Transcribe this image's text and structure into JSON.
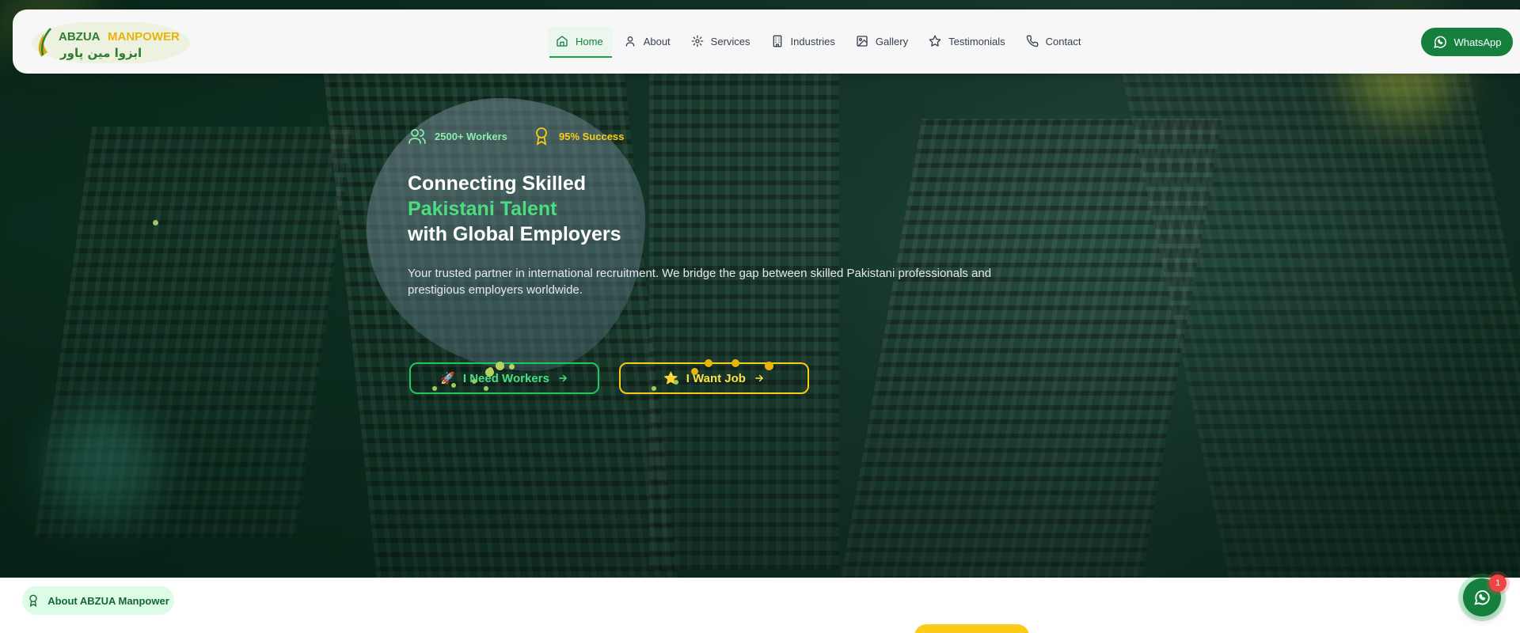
{
  "brand": {
    "name_left": "ABZUA",
    "name_right": "MANPOWER",
    "urdu": "ابزوا مین پاور",
    "colors": {
      "primary_green": "#16a34a",
      "accent_yellow": "#facc15"
    }
  },
  "nav": {
    "items": [
      {
        "label": "Home",
        "icon": "home-icon",
        "active": true
      },
      {
        "label": "About",
        "icon": "user-icon"
      },
      {
        "label": "Services",
        "icon": "gear-icon"
      },
      {
        "label": "Industries",
        "icon": "building-icon"
      },
      {
        "label": "Gallery",
        "icon": "image-icon"
      },
      {
        "label": "Testimonials",
        "icon": "star-icon"
      },
      {
        "label": "Contact",
        "icon": "phone-icon"
      }
    ],
    "whatsapp_label": "WhatsApp"
  },
  "hero": {
    "stats": [
      {
        "label": "2500+ Workers",
        "icon": "users-icon"
      },
      {
        "label": "95% Success",
        "icon": "award-icon"
      }
    ],
    "headline": {
      "line1": "Connecting Skilled",
      "line2": "Pakistani Talent",
      "line3": "with Global Employers"
    },
    "subtitle": "Your trusted partner in international recruitment. We bridge the gap between skilled Pakistani professionals and prestigious employers worldwide.",
    "cta_primary": {
      "emoji": "🚀",
      "label": "I Need Workers",
      "icon": "arrow-right-icon"
    },
    "cta_secondary": {
      "emoji": "⭐",
      "label": "I Want Job",
      "icon": "arrow-right-icon"
    }
  },
  "about_section": {
    "pill_label": "About ABZUA Manpower",
    "icon": "award-icon"
  },
  "floating_whatsapp": {
    "badge_count": "1",
    "icon": "whatsapp-icon"
  }
}
